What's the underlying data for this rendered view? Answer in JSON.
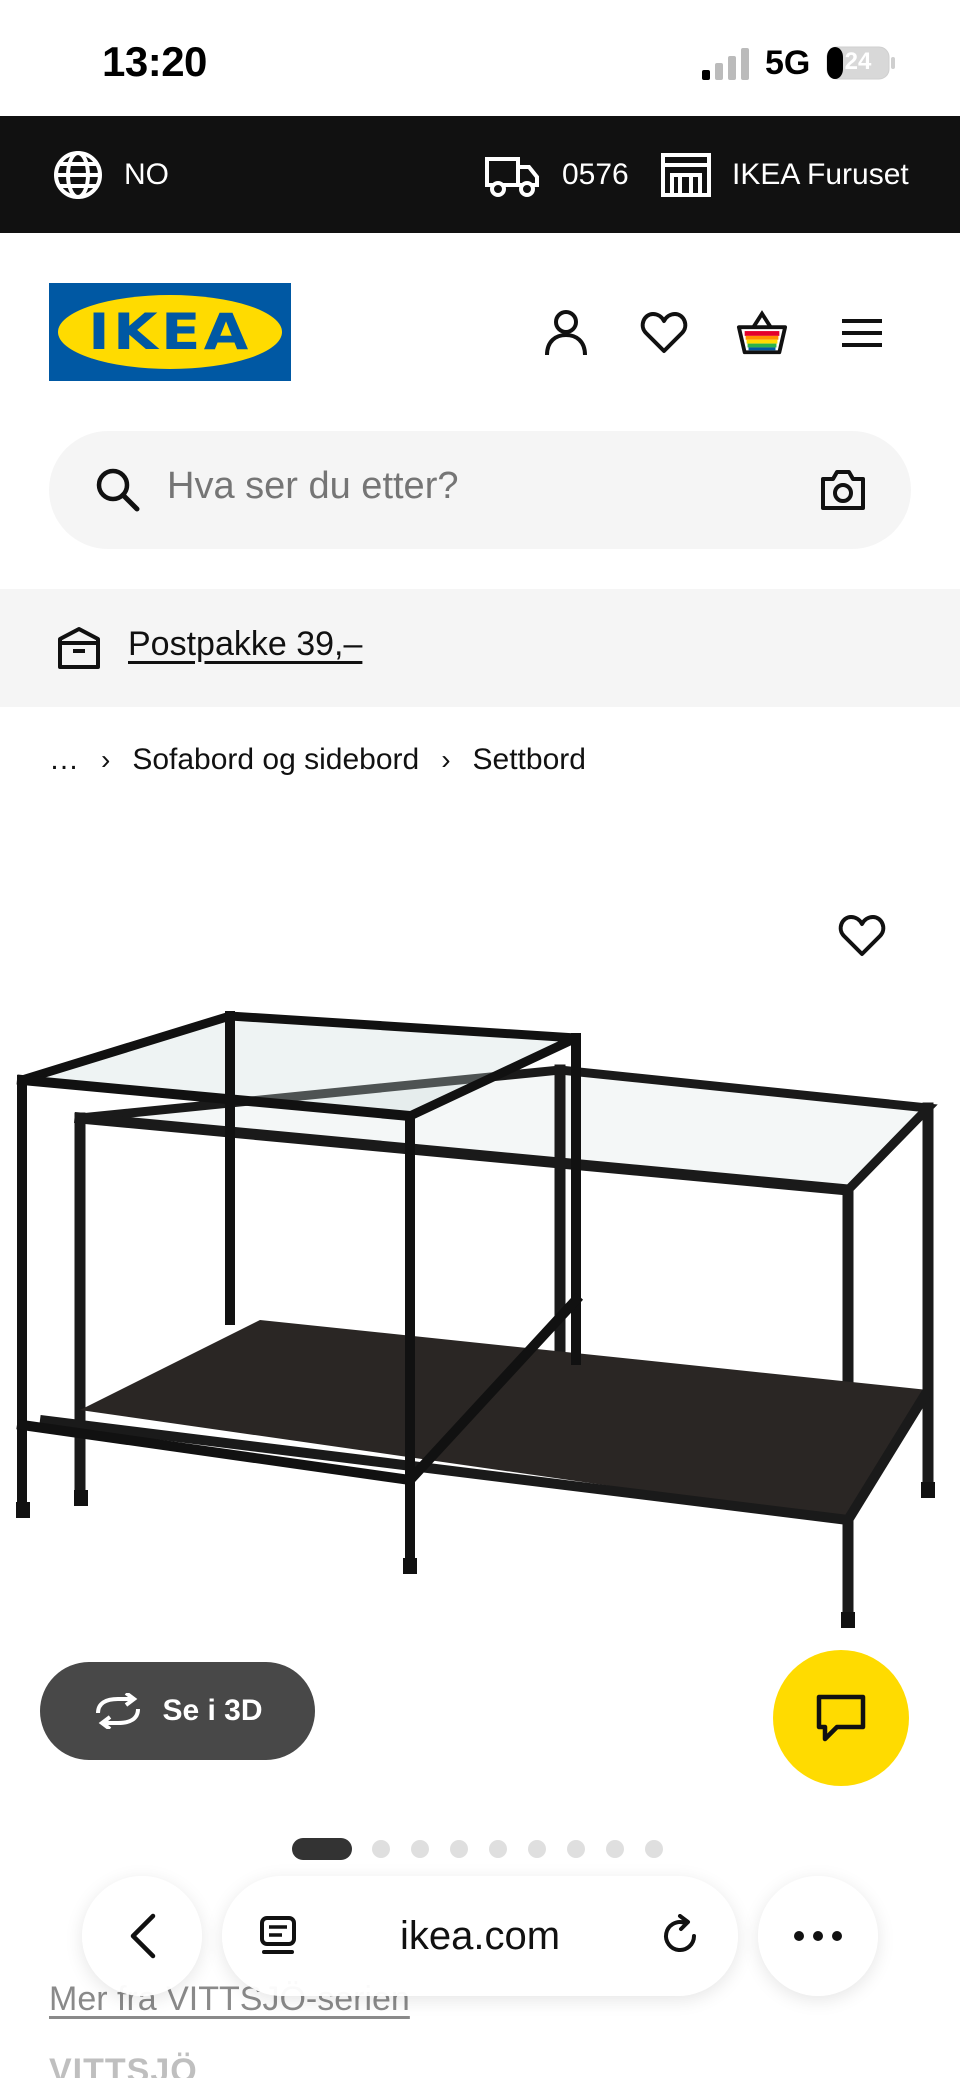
{
  "status_bar": {
    "time": "13:20",
    "network": "5G",
    "battery": "24"
  },
  "topbar": {
    "language": "NO",
    "postal_code": "0576",
    "store": "IKEA Furuset"
  },
  "header": {
    "logo_text": "IKEA"
  },
  "search": {
    "placeholder": "Hva ser du etter?"
  },
  "promo": {
    "text": "Postpakke 39,–"
  },
  "breadcrumb": {
    "ellipsis": "…",
    "items": [
      "Sofabord og sidebord",
      "Settbord"
    ]
  },
  "product": {
    "see_3d_label": "Se i 3D",
    "image_count": 10,
    "active_image": 1
  },
  "below_fold": {
    "series_link": "Mer fra VITTSJÖ-serien",
    "product_name": "VITTSJÖ"
  },
  "browser": {
    "url": "ikea.com"
  },
  "colors": {
    "ikea_blue": "#0058a3",
    "ikea_yellow": "#ffdb00",
    "topbar_bg": "#111111"
  }
}
